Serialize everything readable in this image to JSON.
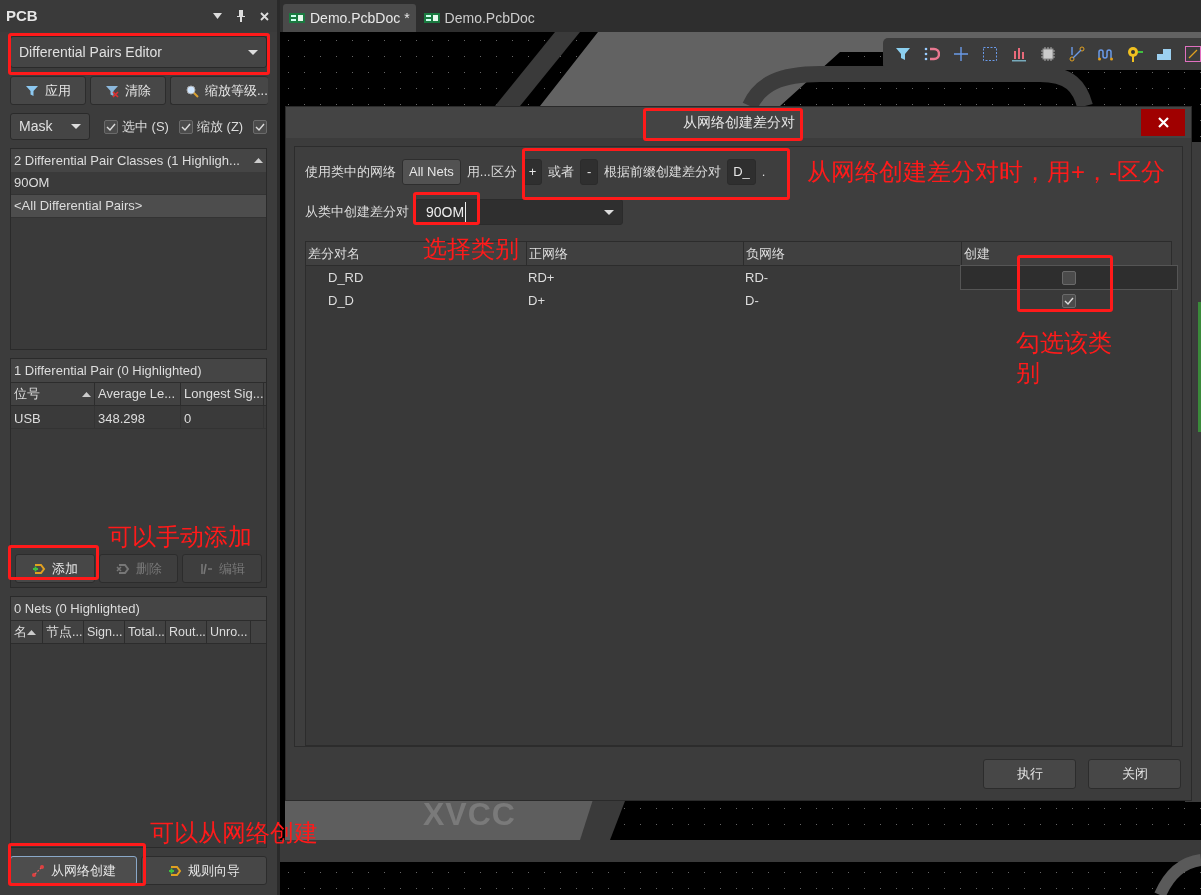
{
  "panel": {
    "title": "PCB",
    "mode": "Differential Pairs Editor",
    "filter_buttons": [
      {
        "kind": "apply",
        "label": "应用"
      },
      {
        "kind": "clear",
        "label": "清除"
      },
      {
        "kind": "zoom",
        "label": "缩放等级..."
      }
    ],
    "mask": "Mask",
    "options": [
      {
        "label": "选中 (S)",
        "checked": true
      },
      {
        "label": "缩放 (Z)",
        "checked": true
      },
      {
        "checked": true
      }
    ],
    "classes": {
      "header": "2 Differential Pair Classes (1 Highligh...",
      "items": [
        {
          "label": "90OM",
          "selected": false
        },
        {
          "label": "<All Differential Pairs>",
          "selected": true
        }
      ]
    },
    "pairs": {
      "header": "1 Differential Pair (0 Highlighted)",
      "columns": [
        "位号",
        "Average Le...",
        "Longest Sig..."
      ],
      "rows": [
        [
          "USB",
          "348.298",
          "0"
        ]
      ],
      "buttons": [
        {
          "kind": "add",
          "label": "添加",
          "disabled": false
        },
        {
          "kind": "remove",
          "label": "删除",
          "disabled": true
        },
        {
          "kind": "edit",
          "label": "编辑",
          "disabled": true
        }
      ]
    },
    "nets": {
      "header": "0 Nets (0 Highlighted)",
      "columns": [
        "名",
        "节点...",
        "Sign...",
        "Total...",
        "Rout...",
        "Unro..."
      ]
    },
    "bottom_buttons": [
      {
        "kind": "from-net",
        "label": "从网络创建"
      },
      {
        "kind": "wizard",
        "label": "规则向导"
      }
    ]
  },
  "tabs": [
    {
      "label": "Demo.PcbDoc *",
      "selected": true
    },
    {
      "label": "Demo.PcbDoc",
      "selected": false
    }
  ],
  "canvas": {
    "label": "XVCC"
  },
  "dialog": {
    "title": "从网络创建差分对",
    "row1": [
      {
        "kind": "text",
        "text": "使用类中的网络"
      },
      {
        "kind": "button",
        "text": "All Nets"
      },
      {
        "kind": "text",
        "text": "用...区分"
      },
      {
        "kind": "field",
        "text": "+"
      },
      {
        "kind": "text",
        "text": "或者"
      },
      {
        "kind": "field",
        "text": "-"
      },
      {
        "kind": "text",
        "text": "根据前缀创建差分对"
      },
      {
        "kind": "field",
        "text": "D_"
      },
      {
        "kind": "text",
        "text": "."
      }
    ],
    "class_label": "从类中创建差分对",
    "class_value": "90OM",
    "columns": [
      "差分对名",
      "正网络",
      "负网络",
      "创建"
    ],
    "rows": [
      {
        "name": "D_RD",
        "positive": "RD+",
        "negative": "RD-",
        "checked": false
      },
      {
        "name": "D_D",
        "positive": "D+",
        "negative": "D-",
        "checked": true
      }
    ],
    "buttons": [
      "执行",
      "关闭"
    ]
  },
  "annotations": [
    "从网络创建差分对时，用+，-区分",
    "选择类别",
    "勾选该类别",
    "可以手动添加",
    "可以从网络创建"
  ]
}
